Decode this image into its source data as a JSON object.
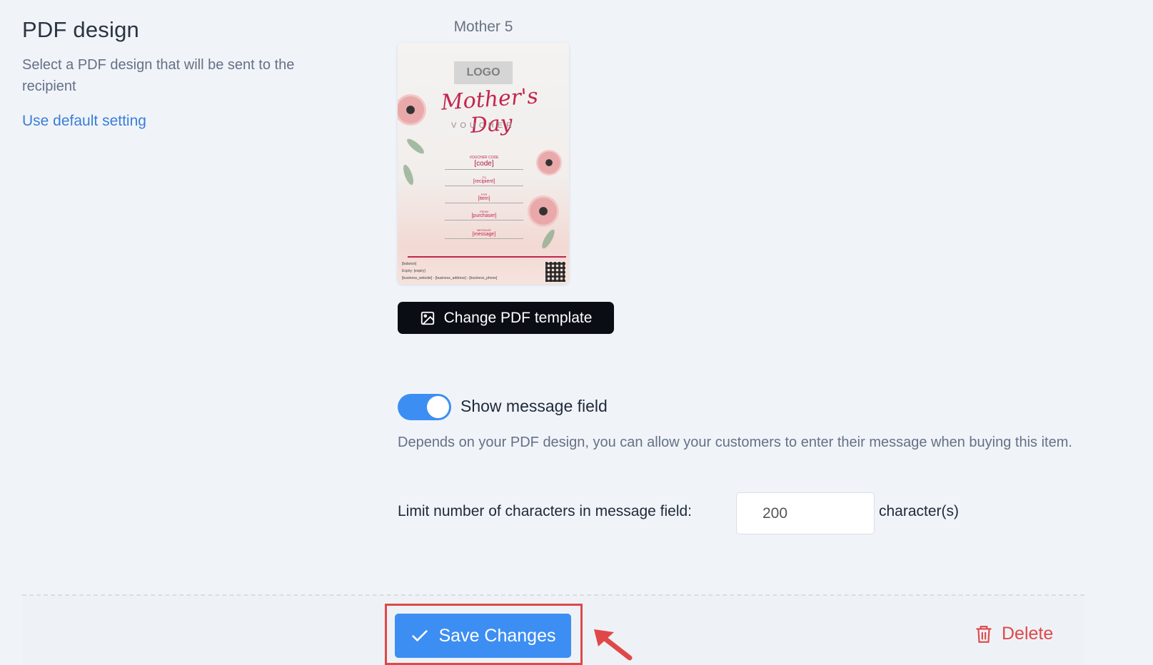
{
  "pdf_design": {
    "title": "PDF design",
    "description": "Select a PDF design that will be sent to the recipient",
    "default_link": "Use default setting",
    "design_name": "Mother 5",
    "change_button": "Change PDF template"
  },
  "preview": {
    "logo": "LOGO",
    "title": "Mother's Day",
    "subtitle": "VOUCHER",
    "fields": [
      {
        "label": "VOUCHER CODE",
        "value": "[code]"
      },
      {
        "label": "TO",
        "value": "[recipient]"
      },
      {
        "label": "FOR",
        "value": "[item]"
      },
      {
        "label": "FROM",
        "value": "[purchaser]"
      },
      {
        "label": "MESSAGE",
        "value": "[message]"
      }
    ],
    "balance": "[balance]",
    "expiry": "Expiry: [expiry]",
    "business": "[business_website] - [business_address] - [business_phone]"
  },
  "message_field": {
    "toggle_label": "Show message field",
    "toggle_on": true,
    "help": "Depends on your PDF design, you can allow your customers to enter their message when buying this item.",
    "limit_label": "Limit number of characters in message field:",
    "limit_value": "200",
    "limit_unit": "character(s)"
  },
  "footer": {
    "save_label": "Save Changes",
    "delete_label": "Delete"
  },
  "colors": {
    "primary": "#3d8ef2",
    "danger": "#e04848",
    "dark_button": "#0a0d14",
    "link": "#3b7dd8"
  }
}
